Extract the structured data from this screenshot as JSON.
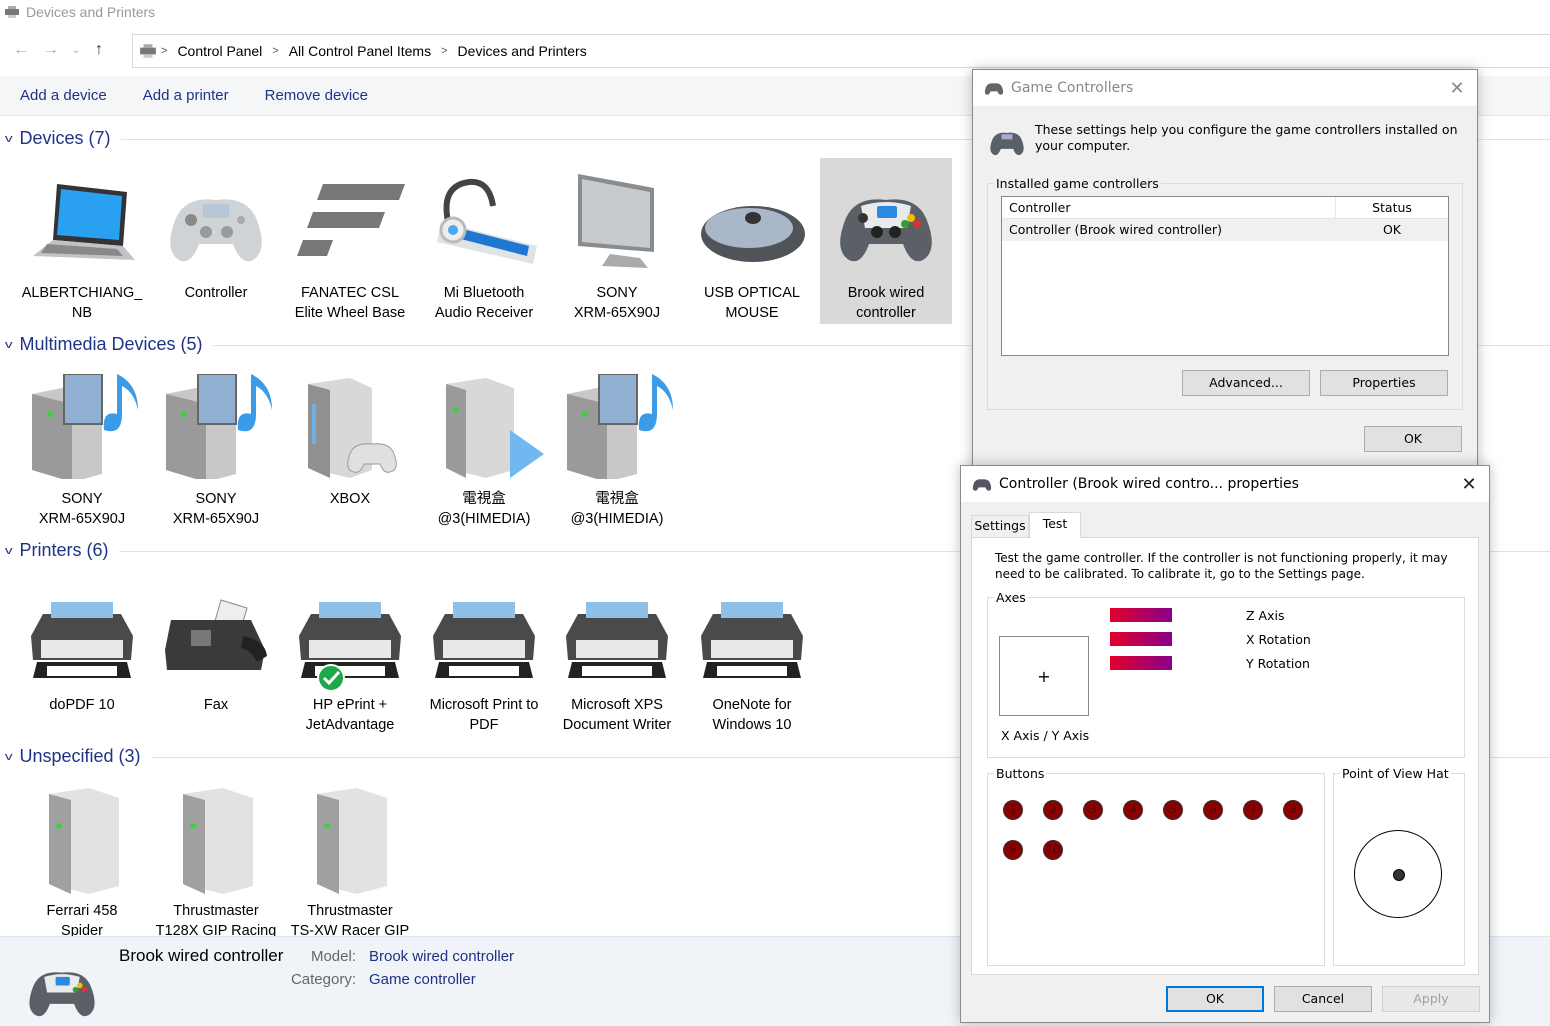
{
  "window": {
    "title": "Devices and Printers"
  },
  "nav": {
    "breadcrumbs": [
      "Control Panel",
      "All Control Panel Items",
      "Devices and Printers"
    ]
  },
  "commands": [
    "Add a device",
    "Add a printer",
    "Remove device"
  ],
  "groups": {
    "devices": {
      "title": "Devices (7)",
      "items": [
        {
          "line1": "ALBERTCHIANG_",
          "line2": "NB",
          "icon": "laptop-icon"
        },
        {
          "line1": "Controller",
          "line2": "",
          "icon": "gamepad-icon"
        },
        {
          "line1": "FANATEC CSL",
          "line2": "Elite Wheel Base",
          "icon": "fanatec-logo-icon"
        },
        {
          "line1": "Mi Bluetooth",
          "line2": "Audio Receiver",
          "icon": "headset-icon"
        },
        {
          "line1": "SONY",
          "line2": "XRM-65X90J",
          "icon": "monitor-icon"
        },
        {
          "line1": "USB OPTICAL",
          "line2": "MOUSE",
          "icon": "mouse-icon"
        },
        {
          "line1": "Brook wired",
          "line2": "controller",
          "icon": "gamepad-icon"
        }
      ]
    },
    "multimedia": {
      "title": "Multimedia Devices (5)",
      "items": [
        {
          "line1": "SONY",
          "line2": "XRM-65X90J",
          "icon": "media-server-icon"
        },
        {
          "line1": "SONY",
          "line2": "XRM-65X90J",
          "icon": "media-server-icon"
        },
        {
          "line1": "XBOX",
          "line2": "",
          "icon": "xbox-icon"
        },
        {
          "line1": "電視盒",
          "line2": "@3(HIMEDIA)",
          "icon": "media-play-icon"
        },
        {
          "line1": "電視盒",
          "line2": "@3(HIMEDIA)",
          "icon": "media-server-icon"
        }
      ]
    },
    "printers": {
      "title": "Printers (6)",
      "items": [
        {
          "line1": "doPDF 10",
          "line2": "",
          "icon": "printer-icon"
        },
        {
          "line1": "Fax",
          "line2": "",
          "icon": "fax-icon"
        },
        {
          "line1": "HP ePrint +",
          "line2": "JetAdvantage",
          "icon": "printer-default-icon"
        },
        {
          "line1": "Microsoft Print to",
          "line2": "PDF",
          "icon": "printer-icon"
        },
        {
          "line1": "Microsoft XPS",
          "line2": "Document Writer",
          "icon": "printer-icon"
        },
        {
          "line1": "OneNote for",
          "line2": "Windows 10",
          "icon": "printer-icon"
        }
      ]
    },
    "unspecified": {
      "title": "Unspecified (3)",
      "items": [
        {
          "line1": "Ferrari 458",
          "line2": "Spider",
          "icon": "tower-icon"
        },
        {
          "line1": "Thrustmaster",
          "line2": "T128X GIP Racing",
          "icon": "tower-icon"
        },
        {
          "line1": "Thrustmaster",
          "line2": "TS-XW Racer GIP",
          "icon": "tower-icon"
        }
      ]
    }
  },
  "details": {
    "name": "Brook wired controller",
    "model_label": "Model:",
    "model_value": "Brook wired controller",
    "category_label": "Category:",
    "category_value": "Game controller"
  },
  "game_controllers": {
    "title": "Game Controllers",
    "intro": "These settings help you configure the game controllers installed on your computer.",
    "group_label": "Installed game controllers",
    "col_controller": "Controller",
    "col_status": "Status",
    "rows": [
      {
        "controller": "Controller (Brook wired controller)",
        "status": "OK"
      }
    ],
    "advanced": "Advanced...",
    "properties": "Properties",
    "ok": "OK"
  },
  "properties": {
    "title": "Controller (Brook wired contro... properties",
    "tabs": [
      "Settings",
      "Test"
    ],
    "active_tab": "Test",
    "intro": "Test the game controller.  If the controller is not functioning properly, it may need to be calibrated.  To calibrate it, go to the Settings page.",
    "axes_label": "Axes",
    "xy_label": "X Axis / Y Axis",
    "axes": [
      "Z Axis",
      "X Rotation",
      "Y Rotation"
    ],
    "buttons_label": "Buttons",
    "button_numbers": [
      "1",
      "2",
      "3",
      "4",
      "5",
      "6",
      "7",
      "8",
      "9",
      "10"
    ],
    "pov_label": "Point of View Hat",
    "ok": "OK",
    "cancel": "Cancel",
    "apply": "Apply"
  }
}
